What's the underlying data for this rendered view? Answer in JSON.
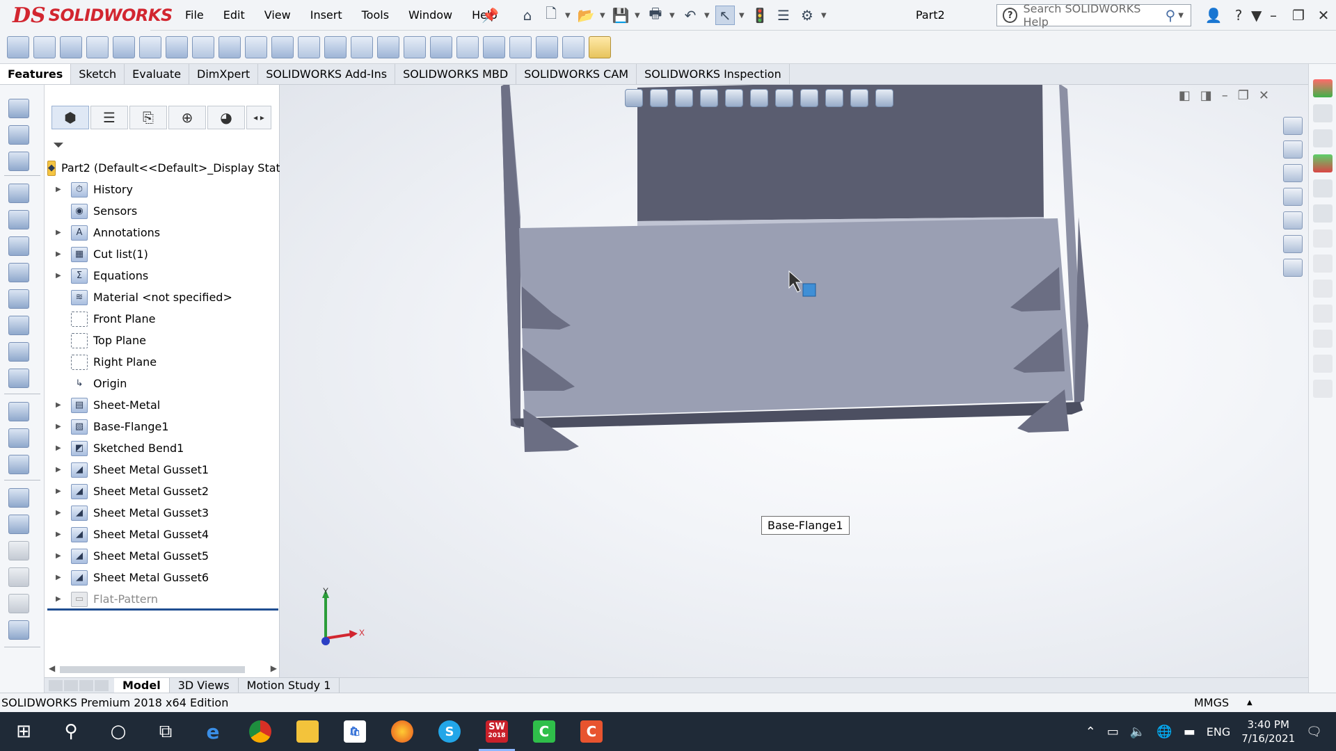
{
  "app": {
    "brand": "SOLIDWORKS",
    "document_title": "Part2",
    "menus": [
      "File",
      "Edit",
      "View",
      "Insert",
      "Tools",
      "Window",
      "Help"
    ],
    "search_placeholder": "Search SOLIDWORKS Help"
  },
  "command_tabs": [
    "Features",
    "Sketch",
    "Evaluate",
    "DimXpert",
    "SOLIDWORKS Add-Ins",
    "SOLIDWORKS MBD",
    "SOLIDWORKS CAM",
    "SOLIDWORKS Inspection"
  ],
  "feature_tree": {
    "root": "Part2  (Default<<Default>_Display State",
    "items": [
      {
        "label": "History",
        "expandable": true,
        "icon": "history-icon"
      },
      {
        "label": "Sensors",
        "expandable": false,
        "icon": "sensors-icon"
      },
      {
        "label": "Annotations",
        "expandable": true,
        "icon": "annotations-icon"
      },
      {
        "label": "Cut list(1)",
        "expandable": true,
        "icon": "cut-list-icon"
      },
      {
        "label": "Equations",
        "expandable": true,
        "icon": "equations-icon"
      },
      {
        "label": "Material <not specified>",
        "expandable": false,
        "icon": "material-icon"
      },
      {
        "label": "Front Plane",
        "expandable": false,
        "icon": "plane-icon"
      },
      {
        "label": "Top Plane",
        "expandable": false,
        "icon": "plane-icon"
      },
      {
        "label": "Right Plane",
        "expandable": false,
        "icon": "plane-icon"
      },
      {
        "label": "Origin",
        "expandable": false,
        "icon": "origin-icon"
      },
      {
        "label": "Sheet-Metal",
        "expandable": true,
        "icon": "sheet-metal-icon"
      },
      {
        "label": "Base-Flange1",
        "expandable": true,
        "icon": "base-flange-icon"
      },
      {
        "label": "Sketched Bend1",
        "expandable": true,
        "icon": "sketched-bend-icon"
      },
      {
        "label": "Sheet Metal Gusset1",
        "expandable": true,
        "icon": "gusset-icon"
      },
      {
        "label": "Sheet Metal Gusset2",
        "expandable": true,
        "icon": "gusset-icon"
      },
      {
        "label": "Sheet Metal Gusset3",
        "expandable": true,
        "icon": "gusset-icon"
      },
      {
        "label": "Sheet Metal Gusset4",
        "expandable": true,
        "icon": "gusset-icon"
      },
      {
        "label": "Sheet Metal Gusset5",
        "expandable": true,
        "icon": "gusset-icon"
      },
      {
        "label": "Sheet Metal Gusset6",
        "expandable": true,
        "icon": "gusset-icon"
      },
      {
        "label": "Flat-Pattern",
        "expandable": true,
        "icon": "flat-pattern-icon",
        "disabled": true
      }
    ]
  },
  "viewport": {
    "tooltip": "Base-Flange1",
    "triad_x": "X",
    "triad_y": "Y"
  },
  "bottom_tabs": [
    "Model",
    "3D Views",
    "Motion Study 1"
  ],
  "status": {
    "edition": "SOLIDWORKS Premium 2018 x64 Edition",
    "units": "MMGS"
  },
  "taskbar": {
    "sw_label": "2018",
    "sw_text": "SW",
    "language": "ENG",
    "time": "3:40 PM",
    "date": "7/16/2021"
  },
  "colors": {
    "brand_red": "#d22630",
    "part_face": "#9a9fb3",
    "part_dark": "#5f6275",
    "selection_blue": "#1f4e91"
  }
}
